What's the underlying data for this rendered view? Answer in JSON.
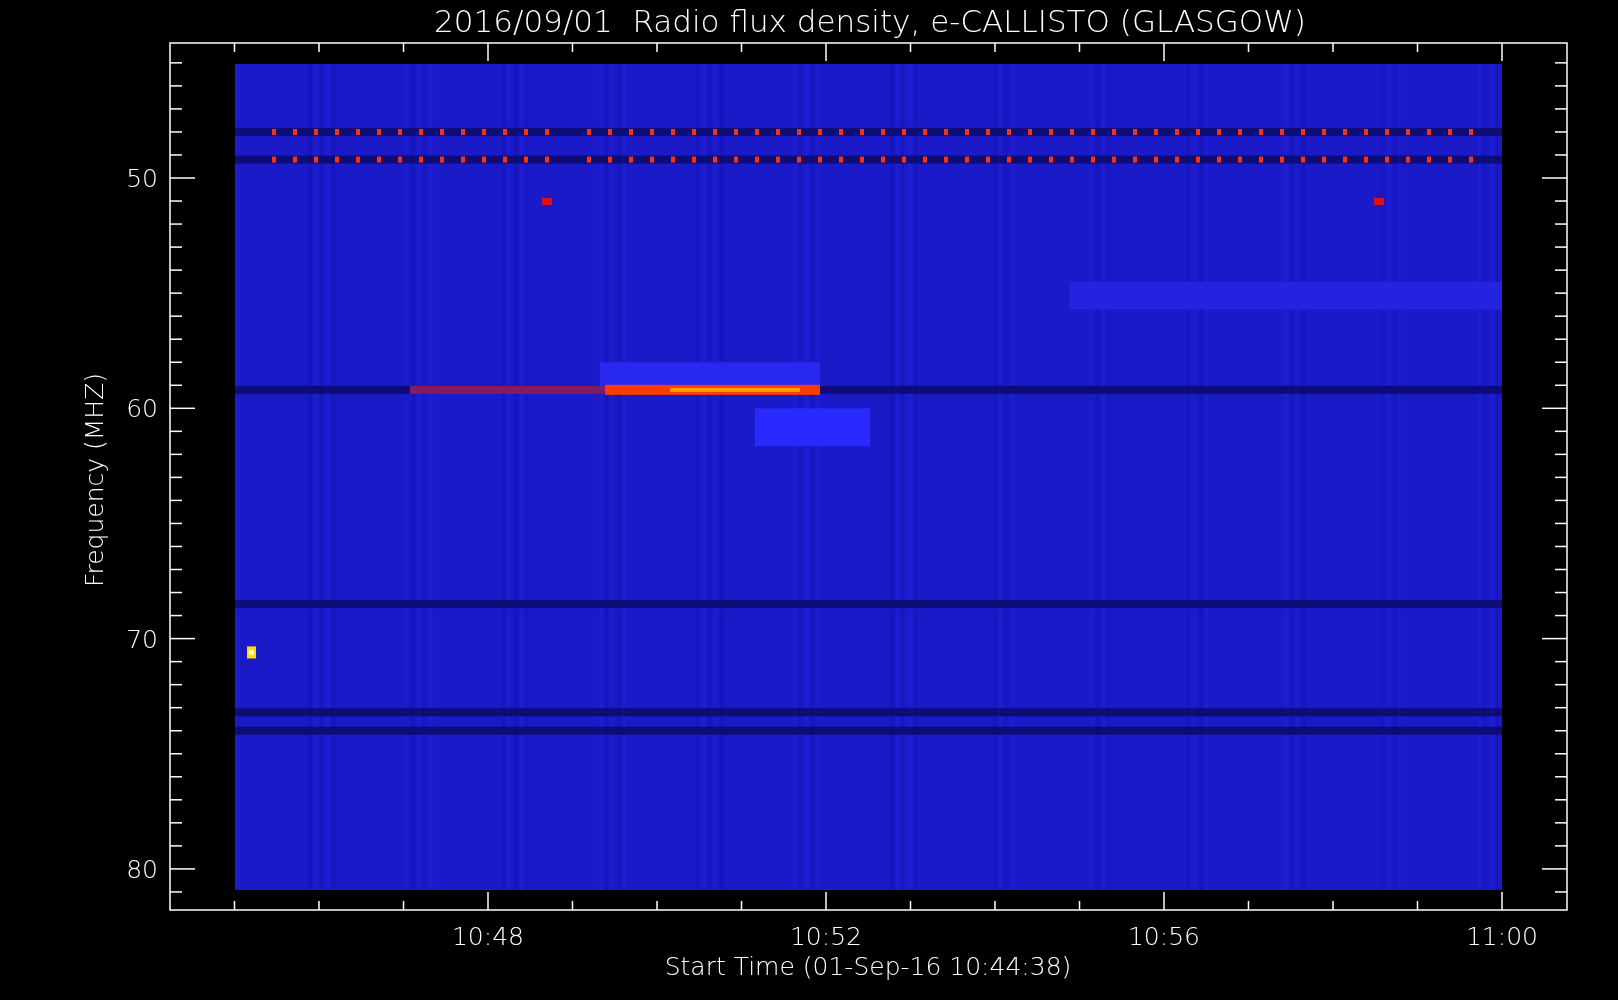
{
  "title": "2016/09/01  Radio flux density, e-CALLISTO (GLASGOW)",
  "y_axis": {
    "label": "Frequency (MHZ)",
    "ticks": [
      "50",
      "60",
      "70",
      "80"
    ]
  },
  "x_axis": {
    "label": "Start Time (01-Sep-16 10:44:38)",
    "ticks": [
      "10:48",
      "10:52",
      "10:56",
      "11:00"
    ]
  }
}
